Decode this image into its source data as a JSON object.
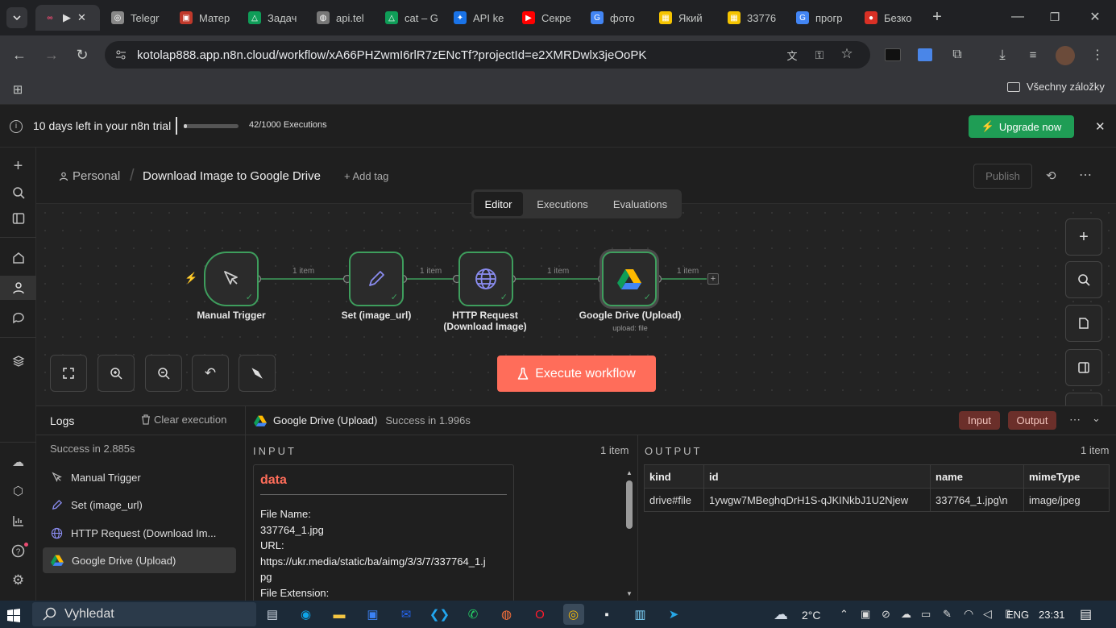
{
  "browser": {
    "tabs": [
      {
        "label": "",
        "icon": "n8n-icon"
      },
      {
        "label": "Telegr",
        "icon": "chatgpt-icon"
      },
      {
        "label": "Матер",
        "icon": "site-icon"
      },
      {
        "label": "Задач",
        "icon": "google-drive-icon"
      },
      {
        "label": "api.tel",
        "icon": "globe-icon"
      },
      {
        "label": "cat – G",
        "icon": "google-drive-icon"
      },
      {
        "label": "API ke",
        "icon": "api-icon"
      },
      {
        "label": "Секре",
        "icon": "youtube-icon"
      },
      {
        "label": "фото",
        "icon": "google-icon"
      },
      {
        "label": "Який",
        "icon": "image-icon"
      },
      {
        "label": "33776",
        "icon": "image-icon"
      },
      {
        "label": "прогр",
        "icon": "google-icon"
      },
      {
        "label": "Безко",
        "icon": "record-icon"
      }
    ],
    "url": "kotolap888.app.n8n.cloud/workflow/xA66PHZwmI6rlR7zENcTf?projectId=e2XMRDwlx3jeOoPK",
    "bookmarks_label": "Všechny záložky"
  },
  "trial": {
    "text": "10 days left in your n8n trial",
    "executions": "42/1000 Executions",
    "progress": 0.042,
    "upgrade_label": "Upgrade now"
  },
  "header": {
    "project": "Personal",
    "workflow_name": "Download Image to Google Drive",
    "add_tag": "+ Add tag",
    "publish": "Publish",
    "tabs": [
      "Editor",
      "Executions",
      "Evaluations"
    ],
    "active_tab": "Editor"
  },
  "canvas": {
    "nodes": [
      {
        "name": "Manual Trigger",
        "sub": "",
        "icon": "cursor-icon"
      },
      {
        "name": "Set (image_url)",
        "sub": "",
        "icon": "pencil-icon"
      },
      {
        "name": "HTTP Request (Download Image)",
        "line1": "HTTP Request",
        "line2": "(Download Image)",
        "icon": "globe-icon"
      },
      {
        "name": "Google Drive (Upload)",
        "sub": "upload: file",
        "icon": "google-drive-icon"
      }
    ],
    "edges": [
      "1 item",
      "1 item",
      "1 item",
      "1 item"
    ],
    "execute_label": "Execute workflow"
  },
  "logs": {
    "title": "Logs",
    "clear": "Clear execution",
    "status": "Success in 2.885s",
    "items": [
      {
        "label": "Manual Trigger",
        "icon": "cursor-icon"
      },
      {
        "label": "Set (image_url)",
        "icon": "pencil-icon"
      },
      {
        "label": "HTTP Request (Download Im...",
        "icon": "globe-icon"
      },
      {
        "label": "Google Drive (Upload)",
        "icon": "google-drive-icon"
      }
    ]
  },
  "panel": {
    "node": "Google Drive (Upload)",
    "status": "Success in 1.996s",
    "input_btn": "Input",
    "output_btn": "Output",
    "input": {
      "title": "INPUT",
      "count": "1 item",
      "data_title": "data",
      "lines": [
        "File Name:",
        "337764_1.jpg",
        "URL:",
        "https://ukr.media/static/ba/aimg/3/3/7/337764_1.j",
        "pg",
        "File Extension:"
      ]
    },
    "output": {
      "title": "OUTPUT",
      "count": "1 item",
      "columns": [
        "kind",
        "id",
        "name",
        "mimeType"
      ],
      "rows": [
        [
          "drive#file",
          "1ywgw7MBeghqDrH1S-qJKINkbJ1U2Njew",
          "337764_1.jpg\\n",
          "image/jpeg"
        ]
      ]
    }
  },
  "taskbar": {
    "search": "Vyhledat",
    "weather": "2°C",
    "lang": "ENG",
    "time": "23:31"
  },
  "colors": {
    "accent": "#ea4b71",
    "green": "#1f9d55",
    "execute": "#ff6d5a",
    "node_border": "#3e9e5d"
  }
}
